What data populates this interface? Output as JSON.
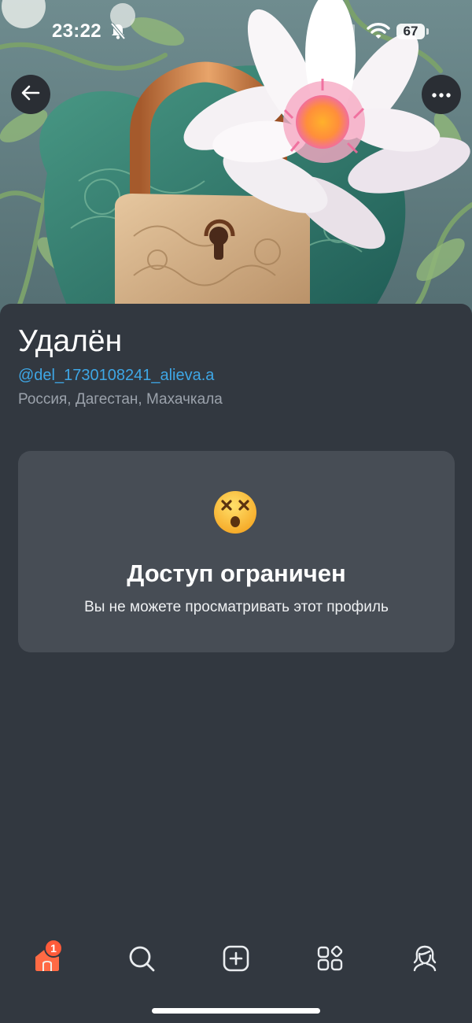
{
  "status_bar": {
    "time": "23:22",
    "battery": "67",
    "icons": [
      "bell-off-icon",
      "signal-icon",
      "wifi-icon",
      "battery-icon"
    ]
  },
  "header": {
    "back_icon": "arrow-left-icon",
    "more_icon": "more-horizontal-icon"
  },
  "profile": {
    "name": "Удалён",
    "handle": "@del_1730108241_alieva.a",
    "location": "Россия, Дагестан, Махачкала"
  },
  "restricted": {
    "emoji": "dizzy-face-icon",
    "title": "Доступ ограничен",
    "text": "Вы не можете просматривать этот профиль"
  },
  "tab_bar": {
    "items": [
      {
        "icon": "home-icon",
        "active": true,
        "badge": "1"
      },
      {
        "icon": "search-icon",
        "active": false
      },
      {
        "icon": "add-post-icon",
        "active": false
      },
      {
        "icon": "services-icon",
        "active": false
      },
      {
        "icon": "profile-icon",
        "active": false
      }
    ]
  },
  "colors": {
    "background": "#323840",
    "card": "#474d55",
    "link": "#3ea7e6",
    "secondary_text": "#9ba2ab",
    "active_tab": "#ff6a44",
    "badge": "#ff5b3a"
  }
}
